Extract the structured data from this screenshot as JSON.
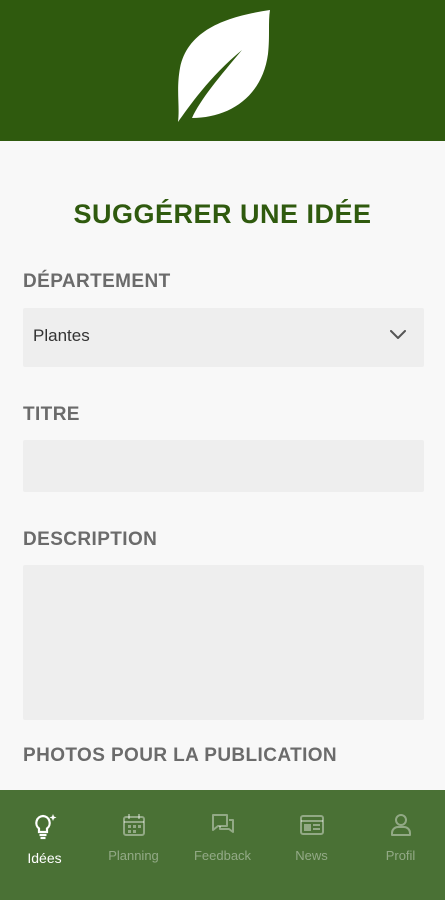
{
  "header": {
    "logo_icon": "leaf-icon",
    "brand_color": "#2f5a0e"
  },
  "form": {
    "title": "SUGGÉRER UNE IDÉE",
    "department": {
      "label": "DÉPARTEMENT",
      "value": "Plantes",
      "icon": "chevron-down-icon"
    },
    "titre": {
      "label": "TITRE",
      "value": ""
    },
    "description": {
      "label": "DESCRIPTION",
      "value": ""
    },
    "photos": {
      "label": "PHOTOS POUR LA PUBLICATION"
    }
  },
  "nav": {
    "background": "#4a7135",
    "items": [
      {
        "label": "Idées",
        "icon": "lightbulb-icon",
        "active": true
      },
      {
        "label": "Planning",
        "icon": "calendar-icon",
        "active": false
      },
      {
        "label": "Feedback",
        "icon": "chat-bubbles-icon",
        "active": false
      },
      {
        "label": "News",
        "icon": "newspaper-icon",
        "active": false
      },
      {
        "label": "Profil",
        "icon": "person-icon",
        "active": false
      }
    ]
  }
}
